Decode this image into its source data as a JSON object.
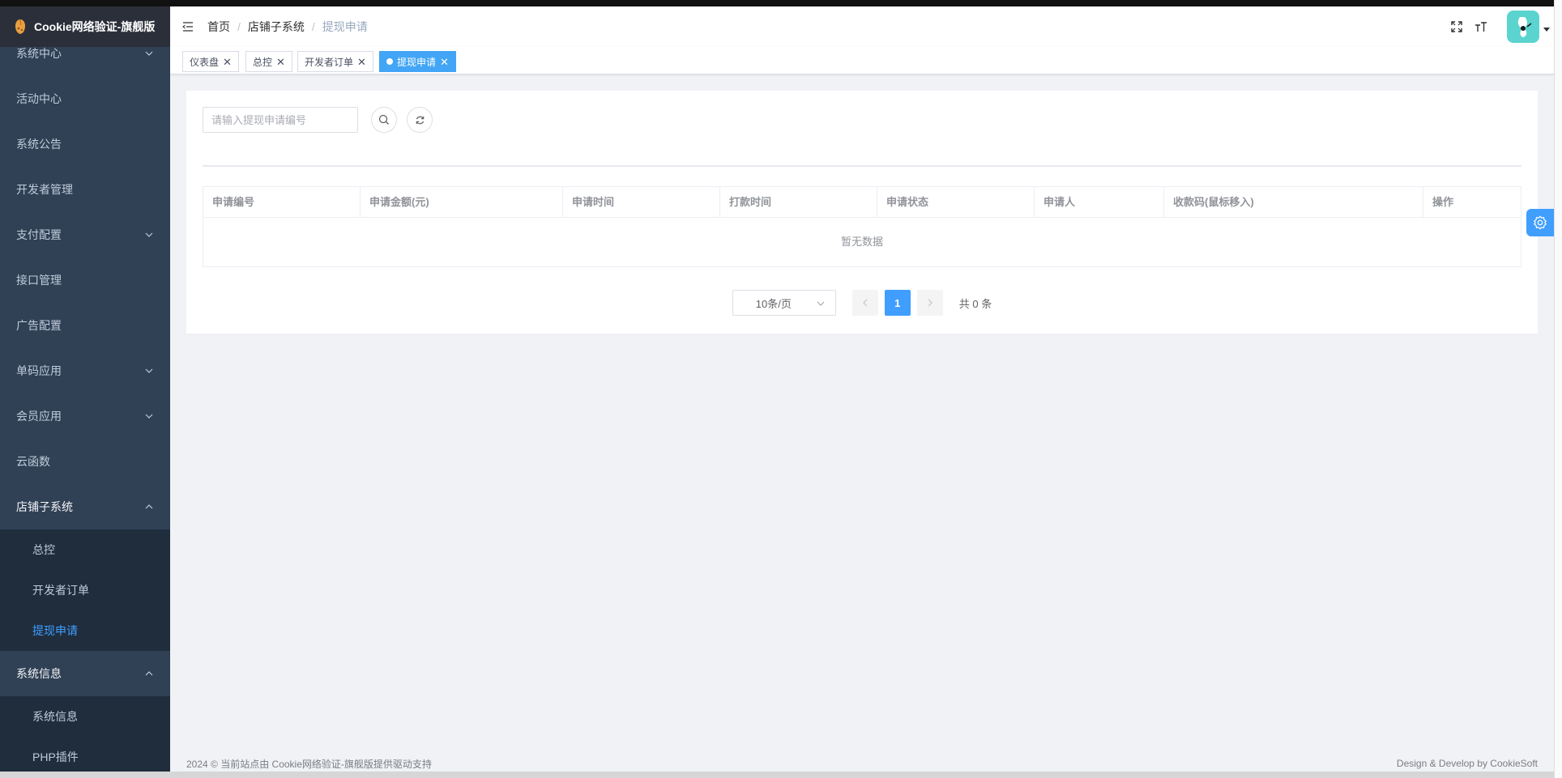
{
  "app": {
    "title": "Cookie网络验证-旗舰版"
  },
  "sidebar": {
    "items": [
      {
        "label": "系统中心",
        "has_arrow": true
      },
      {
        "label": "活动中心"
      },
      {
        "label": "系统公告"
      },
      {
        "label": "开发者管理"
      },
      {
        "label": "支付配置",
        "has_arrow": true
      },
      {
        "label": "接口管理"
      },
      {
        "label": "广告配置"
      },
      {
        "label": "单码应用",
        "has_arrow": true
      },
      {
        "label": "会员应用",
        "has_arrow": true
      },
      {
        "label": "云函数"
      }
    ],
    "shop": {
      "label": "店铺子系统",
      "children": [
        "总控",
        "开发者订单",
        "提现申请"
      ],
      "active_child": "提现申请"
    },
    "sysinfo": {
      "label": "系统信息",
      "children": [
        "系统信息",
        "PHP插件"
      ]
    }
  },
  "navbar": {
    "breadcrumb": [
      "首页",
      "店铺子系统",
      "提现申请"
    ]
  },
  "tags": [
    {
      "label": "仪表盘",
      "active": false
    },
    {
      "label": "总控",
      "active": false
    },
    {
      "label": "开发者订单",
      "active": false
    },
    {
      "label": "提现申请",
      "active": true
    }
  ],
  "search": {
    "placeholder": "请输入提现申请编号"
  },
  "table": {
    "columns": [
      "申请编号",
      "申请金额(元)",
      "申请时间",
      "打款时间",
      "申请状态",
      "申请人",
      "收款码(鼠标移入)",
      "操作"
    ],
    "empty_text": "暂无数据"
  },
  "pagination": {
    "page_size": "10条/页",
    "current_page": "1",
    "total": "共 0 条"
  },
  "footer": {
    "left": "2024 © 当前站点由 Cookie网络验证-旗舰版提供驱动支持",
    "right": "Design & Develop by CookieSoft"
  },
  "colors": {
    "sidebar_bg": "#304156",
    "submenu_bg": "#1f2d3d",
    "accent": "#409eff",
    "tag_active": "#42a5f5"
  }
}
